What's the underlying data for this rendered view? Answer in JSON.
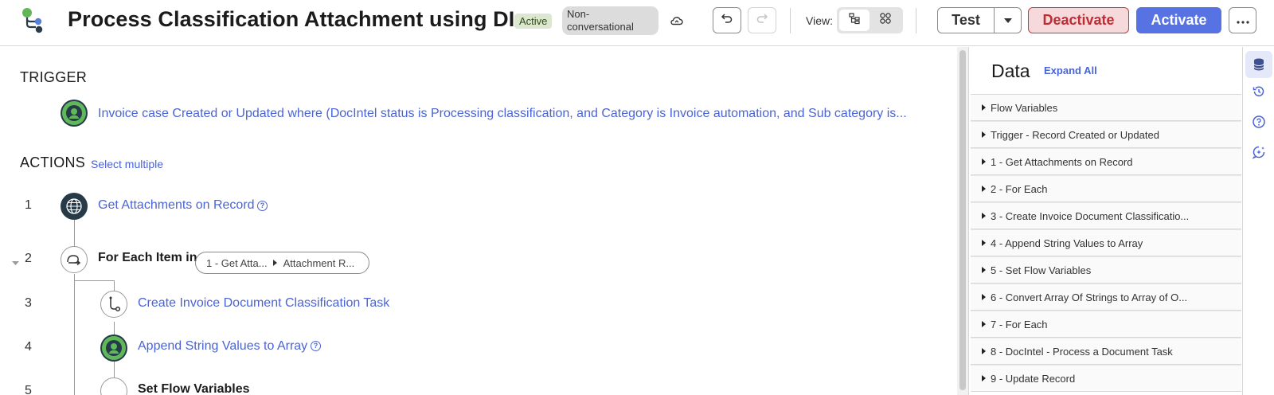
{
  "header": {
    "title": "Process Classification Attachment using DI",
    "status_badge": "Active",
    "mode_badge": "Non-conversational",
    "view_label": "View:",
    "test_label": "Test",
    "deactivate_label": "Deactivate",
    "activate_label": "Activate"
  },
  "trigger": {
    "heading": "TRIGGER",
    "text": "Invoice case Created or Updated where (DocIntel status is Processing classification, and Category is Invoice automation, and Sub category is..."
  },
  "actions": {
    "heading": "ACTIONS",
    "select_multiple": "Select multiple",
    "items": [
      {
        "number": "1",
        "label": "Get Attachments on Record"
      },
      {
        "number": "2",
        "label": "For Each Item in",
        "pill_source": "1 - Get Atta...",
        "pill_field": "Attachment R..."
      },
      {
        "number": "3",
        "label": "Create Invoice Document Classification Task"
      },
      {
        "number": "4",
        "label": "Append String Values to Array"
      },
      {
        "number": "5",
        "label": "Set Flow Variables"
      }
    ]
  },
  "data_panel": {
    "title": "Data",
    "expand_all": "Expand All",
    "items": [
      "Flow Variables",
      "Trigger - Record Created or Updated",
      "1 - Get Attachments on Record",
      "2 - For Each",
      "3 - Create Invoice Document Classificatio...",
      "4 - Append String Values to Array",
      "5 - Set Flow Variables",
      "6 - Convert Array Of Strings to Array of O...",
      "7 - For Each",
      "8 - DocIntel - Process a Document Task",
      "9 - Update Record"
    ]
  },
  "colors": {
    "link": "#4a64d4",
    "activate": "#5672e3",
    "deactivate": "#c02c34",
    "node_dark": "#263a47",
    "node_green": "#5fb85a"
  },
  "icons": {
    "logo": "flow-logo-icon",
    "cloud": "cloud-sync-icon",
    "undo": "undo-icon",
    "redo": "redo-icon",
    "view_tree": "tree-view-icon",
    "view_grid": "grid-view-icon",
    "caret": "chevron-down-icon",
    "more": "more-icon",
    "rail": [
      "database-icon",
      "history-icon",
      "help-icon",
      "assistant-icon"
    ]
  }
}
